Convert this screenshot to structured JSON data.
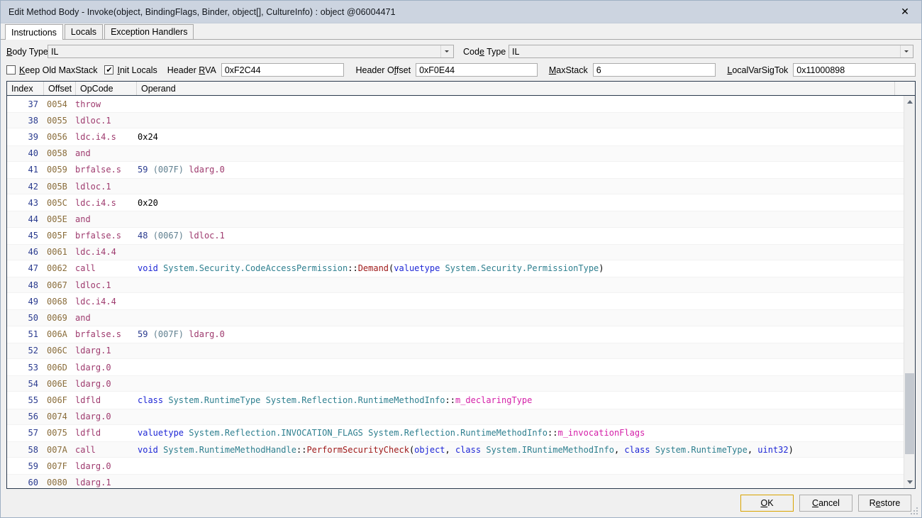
{
  "window": {
    "title": "Edit Method Body - Invoke(object, BindingFlags, Binder, object[], CultureInfo) : object @06004471",
    "close_glyph": "✕"
  },
  "tabs": [
    {
      "label": "Instructions",
      "active": true
    },
    {
      "label": "Locals",
      "active": false
    },
    {
      "label": "Exception Handlers",
      "active": false
    }
  ],
  "form": {
    "body_type_label": "Body Type",
    "body_type_value": "IL",
    "code_type_label": "Code Type",
    "code_type_value": "IL",
    "keep_old_maxstack_label": "Keep Old MaxStack",
    "keep_old_maxstack_checked": false,
    "init_locals_label": "Init Locals",
    "init_locals_checked": true,
    "init_locals_check_glyph": "✔",
    "header_rva_label": "Header RVA",
    "header_rva_value": "0xF2C44",
    "header_offset_label": "Header Offset",
    "header_offset_value": "0xF0E44",
    "maxstack_label": "MaxStack",
    "maxstack_value": "6",
    "localvarsigtok_label": "LocalVarSigTok",
    "localvarsigtok_value": "0x11000898"
  },
  "grid": {
    "columns": [
      "Index",
      "Offset",
      "OpCode",
      "Operand"
    ],
    "rows": [
      {
        "index": "37",
        "offset": "0054",
        "opcode": "throw",
        "operand": []
      },
      {
        "index": "38",
        "offset": "0055",
        "opcode": "ldloc.1",
        "operand": []
      },
      {
        "index": "39",
        "offset": "0056",
        "opcode": "ldc.i4.s",
        "operand": [
          {
            "t": "p",
            "s": "0x24"
          }
        ]
      },
      {
        "index": "40",
        "offset": "0058",
        "opcode": "and",
        "operand": []
      },
      {
        "index": "41",
        "offset": "0059",
        "opcode": "brfalse.s",
        "operand": [
          {
            "t": "n",
            "s": "59"
          },
          {
            "t": "p",
            "s": " "
          },
          {
            "t": "g",
            "s": "(007F)"
          },
          {
            "t": "p",
            "s": " "
          },
          {
            "t": "o",
            "s": "ldarg.0"
          }
        ]
      },
      {
        "index": "42",
        "offset": "005B",
        "opcode": "ldloc.1",
        "operand": []
      },
      {
        "index": "43",
        "offset": "005C",
        "opcode": "ldc.i4.s",
        "operand": [
          {
            "t": "p",
            "s": "0x20"
          }
        ]
      },
      {
        "index": "44",
        "offset": "005E",
        "opcode": "and",
        "operand": []
      },
      {
        "index": "45",
        "offset": "005F",
        "opcode": "brfalse.s",
        "operand": [
          {
            "t": "n",
            "s": "48"
          },
          {
            "t": "p",
            "s": " "
          },
          {
            "t": "g",
            "s": "(0067)"
          },
          {
            "t": "p",
            "s": " "
          },
          {
            "t": "o",
            "s": "ldloc.1"
          }
        ]
      },
      {
        "index": "46",
        "offset": "0061",
        "opcode": "ldc.i4.4",
        "operand": []
      },
      {
        "index": "47",
        "offset": "0062",
        "opcode": "call",
        "operand": [
          {
            "t": "k",
            "s": "void"
          },
          {
            "t": "p",
            "s": " "
          },
          {
            "t": "t",
            "s": "System.Security.CodeAccessPermission"
          },
          {
            "t": "p",
            "s": "::"
          },
          {
            "t": "m",
            "s": "Demand"
          },
          {
            "t": "p",
            "s": "("
          },
          {
            "t": "k",
            "s": "valuetype"
          },
          {
            "t": "p",
            "s": " "
          },
          {
            "t": "t",
            "s": "System.Security.PermissionType"
          },
          {
            "t": "p",
            "s": ")"
          }
        ]
      },
      {
        "index": "48",
        "offset": "0067",
        "opcode": "ldloc.1",
        "operand": []
      },
      {
        "index": "49",
        "offset": "0068",
        "opcode": "ldc.i4.4",
        "operand": []
      },
      {
        "index": "50",
        "offset": "0069",
        "opcode": "and",
        "operand": []
      },
      {
        "index": "51",
        "offset": "006A",
        "opcode": "brfalse.s",
        "operand": [
          {
            "t": "n",
            "s": "59"
          },
          {
            "t": "p",
            "s": " "
          },
          {
            "t": "g",
            "s": "(007F)"
          },
          {
            "t": "p",
            "s": " "
          },
          {
            "t": "o",
            "s": "ldarg.0"
          }
        ]
      },
      {
        "index": "52",
        "offset": "006C",
        "opcode": "ldarg.1",
        "operand": []
      },
      {
        "index": "53",
        "offset": "006D",
        "opcode": "ldarg.0",
        "operand": []
      },
      {
        "index": "54",
        "offset": "006E",
        "opcode": "ldarg.0",
        "operand": []
      },
      {
        "index": "55",
        "offset": "006F",
        "opcode": "ldfld",
        "operand": [
          {
            "t": "k",
            "s": "class"
          },
          {
            "t": "p",
            "s": " "
          },
          {
            "t": "t",
            "s": "System.RuntimeType"
          },
          {
            "t": "p",
            "s": " "
          },
          {
            "t": "t",
            "s": "System.Reflection.RuntimeMethodInfo"
          },
          {
            "t": "p",
            "s": "::"
          },
          {
            "t": "f",
            "s": "m_declaringType"
          }
        ]
      },
      {
        "index": "56",
        "offset": "0074",
        "opcode": "ldarg.0",
        "operand": []
      },
      {
        "index": "57",
        "offset": "0075",
        "opcode": "ldfld",
        "operand": [
          {
            "t": "k",
            "s": "valuetype"
          },
          {
            "t": "p",
            "s": " "
          },
          {
            "t": "t",
            "s": "System.Reflection.INVOCATION_FLAGS"
          },
          {
            "t": "p",
            "s": " "
          },
          {
            "t": "t",
            "s": "System.Reflection.RuntimeMethodInfo"
          },
          {
            "t": "p",
            "s": "::"
          },
          {
            "t": "f",
            "s": "m_invocationFlags"
          }
        ]
      },
      {
        "index": "58",
        "offset": "007A",
        "opcode": "call",
        "operand": [
          {
            "t": "k",
            "s": "void"
          },
          {
            "t": "p",
            "s": " "
          },
          {
            "t": "t",
            "s": "System.RuntimeMethodHandle"
          },
          {
            "t": "p",
            "s": "::"
          },
          {
            "t": "m",
            "s": "PerformSecurityCheck"
          },
          {
            "t": "p",
            "s": "("
          },
          {
            "t": "k",
            "s": "object"
          },
          {
            "t": "p",
            "s": ", "
          },
          {
            "t": "k",
            "s": "class"
          },
          {
            "t": "p",
            "s": " "
          },
          {
            "t": "t",
            "s": "System.IRuntimeMethodInfo"
          },
          {
            "t": "p",
            "s": ", "
          },
          {
            "t": "k",
            "s": "class"
          },
          {
            "t": "p",
            "s": " "
          },
          {
            "t": "t",
            "s": "System.RuntimeType"
          },
          {
            "t": "p",
            "s": ", "
          },
          {
            "t": "k",
            "s": "uint32"
          },
          {
            "t": "p",
            "s": ")"
          }
        ]
      },
      {
        "index": "59",
        "offset": "007F",
        "opcode": "ldarg.0",
        "operand": []
      },
      {
        "index": "60",
        "offset": "0080",
        "opcode": "ldarg.1",
        "operand": []
      }
    ]
  },
  "scrollbar": {
    "thumb_top_pct": 72,
    "thumb_height_pct": 22
  },
  "footer": {
    "ok_label": "OK",
    "cancel_label": "Cancel",
    "restore_label": "Restore"
  }
}
